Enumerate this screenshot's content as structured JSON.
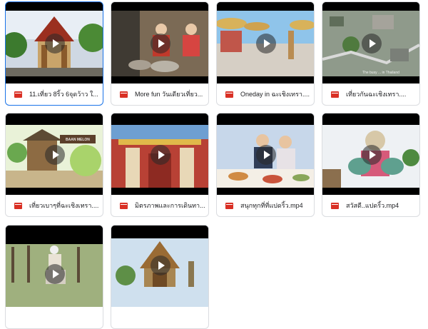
{
  "files": [
    {
      "name": "11.เที่ยว 8ริ้ว 6จุดว้าว ใ...",
      "selected": true
    },
    {
      "name": "More fun วันเดียวเที่ยว...",
      "selected": false
    },
    {
      "name": "Oneday in ฉะเชิงเทรา....",
      "selected": false
    },
    {
      "name": "เที่ยวกันฉะเชิงเทรา....",
      "selected": false
    },
    {
      "name": "เที่ยวเบาๆที่ฉะเชิงเทรา....",
      "selected": false
    },
    {
      "name": "มิตรภาพและการเดินทา...",
      "selected": false
    },
    {
      "name": "สนุกทุกที่ที่แปดริ้ว.mp4",
      "selected": false
    },
    {
      "name": "สวัสดี..แปดริ้ว.mp4",
      "selected": false
    },
    {
      "name": "",
      "selected": false
    },
    {
      "name": "",
      "selected": false
    }
  ],
  "thumb_texts": {
    "sign": "BAAN MELON",
    "caption4": "The busy ... in Thailand"
  },
  "colors": {
    "file_icon": "#d93025",
    "selected_border": "#1a73e8",
    "card_border": "#dadce0"
  }
}
